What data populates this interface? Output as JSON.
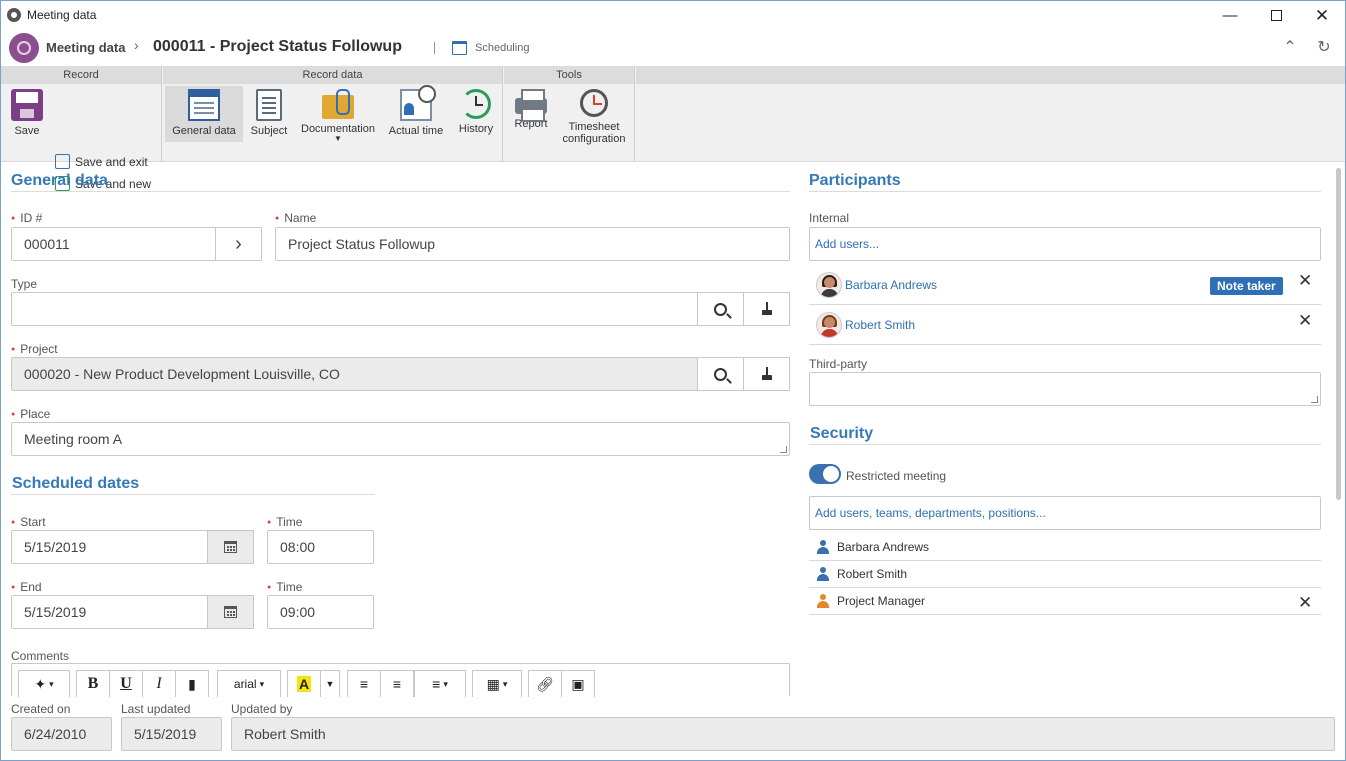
{
  "window": {
    "title": "Meeting data"
  },
  "header": {
    "breadcrumb": "Meeting data",
    "record_title": "000011 - Project Status Followup",
    "context_label": "Scheduling"
  },
  "ribbon": {
    "groups": {
      "record": "Record",
      "record_data": "Record data",
      "tools": "Tools"
    },
    "save": "Save",
    "save_and_exit": "Save and exit",
    "save_and_new": "Save and new",
    "general_data": "General data",
    "subject": "Subject",
    "documentation": "Documentation",
    "actual_time": "Actual time",
    "history": "History",
    "report": "Report",
    "timesheet_configuration": [
      "Timesheet",
      "configuration"
    ]
  },
  "general": {
    "section_title": "General data",
    "id_label": "ID #",
    "id_value": "000011",
    "name_label": "Name",
    "name_value": "Project Status Followup",
    "type_label": "Type",
    "type_value": "",
    "project_label": "Project",
    "project_value": "000020 - New Product Development Louisville, CO",
    "place_label": "Place",
    "place_value": "Meeting room A"
  },
  "scheduled": {
    "section_title": "Scheduled dates",
    "start_label": "Start",
    "start_value": "5/15/2019",
    "start_time_label": "Time",
    "start_time_value": "08:00",
    "end_label": "End",
    "end_value": "5/15/2019",
    "end_time_label": "Time",
    "end_time_value": "09:00"
  },
  "comments": {
    "label": "Comments",
    "font_name": "arial"
  },
  "participants": {
    "section_title": "Participants",
    "internal_label": "Internal",
    "add_users_placeholder": "Add users...",
    "internal": [
      {
        "name": "Barbara Andrews",
        "badge": "Note taker"
      },
      {
        "name": "Robert Smith",
        "badge": ""
      }
    ],
    "third_party_label": "Third-party",
    "third_party_value": ""
  },
  "security": {
    "section_title": "Security",
    "restricted_label": "Restricted meeting",
    "restricted_on": true,
    "add_placeholder": "Add users, teams, departments, positions...",
    "entries": [
      {
        "name": "Barbara Andrews",
        "kind": "user"
      },
      {
        "name": "Robert Smith",
        "kind": "user"
      },
      {
        "name": "Project Manager",
        "kind": "position"
      }
    ]
  },
  "footer": {
    "created_on_label": "Created on",
    "created_on_value": "6/24/2010",
    "last_updated_label": "Last updated",
    "last_updated_value": "5/15/2019",
    "updated_by_label": "Updated by",
    "updated_by_value": "Robert Smith"
  },
  "colors": {
    "accent": "#3579b8",
    "brand": "#8b4f8f",
    "required": "#e53946",
    "badge": "#2f6fb5"
  }
}
